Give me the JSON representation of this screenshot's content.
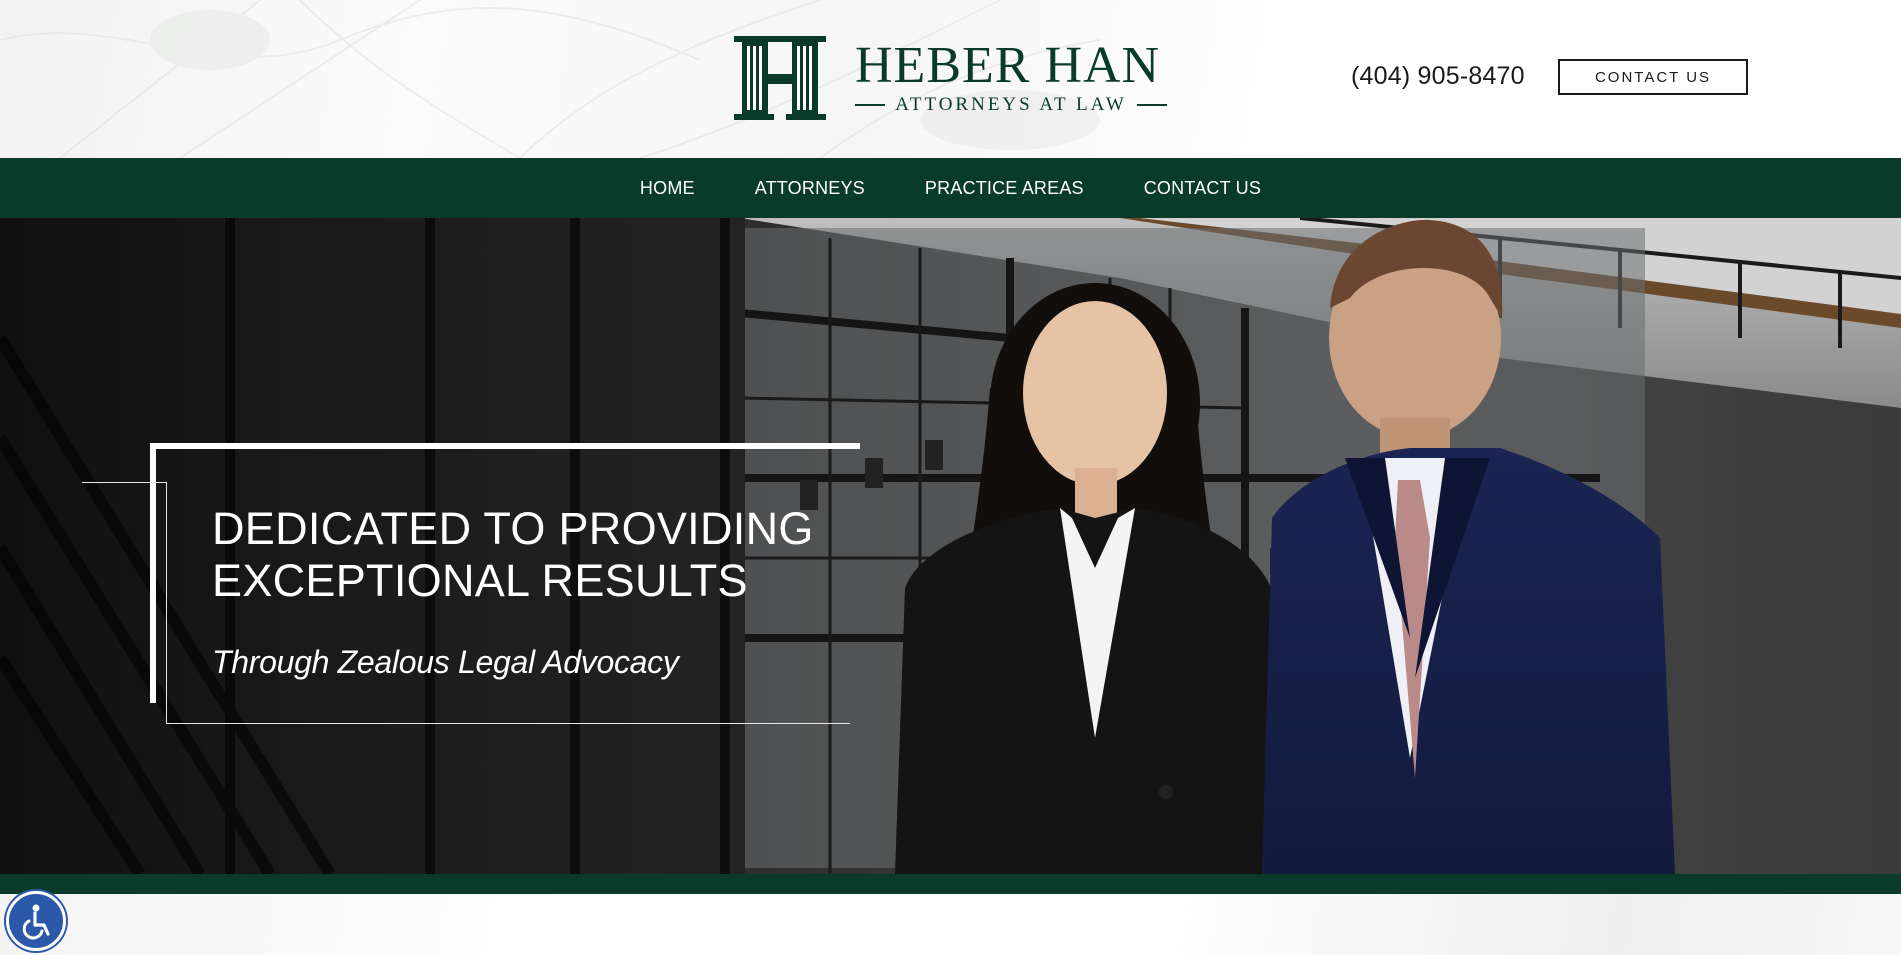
{
  "header": {
    "logo_name": "HEBER HAN",
    "logo_tagline": "ATTORNEYS AT LAW",
    "phone": "(404) 905-8470",
    "contact_button": "CONTACT US"
  },
  "nav": {
    "items": [
      {
        "label": "HOME"
      },
      {
        "label": "ATTORNEYS"
      },
      {
        "label": "PRACTICE AREAS"
      },
      {
        "label": "CONTACT US"
      }
    ]
  },
  "hero": {
    "title_line1": "DEDICATED TO PROVIDING",
    "title_line2": "EXCEPTIONAL RESULTS",
    "subtitle": "Through Zealous Legal Advocacy"
  },
  "accessibility": {
    "icon": "wheelchair-icon"
  },
  "colors": {
    "brand_green": "#0a3a29",
    "accessibility_blue": "#2b58a8"
  }
}
